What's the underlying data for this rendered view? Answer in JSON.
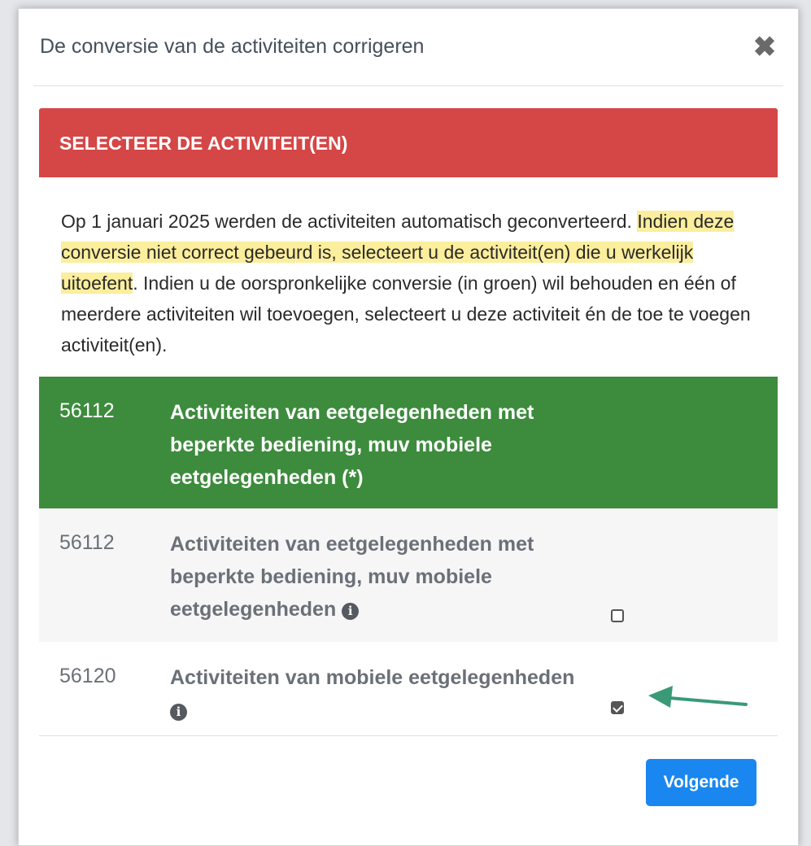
{
  "dialog": {
    "title": "De conversie van de activiteiten corrigeren",
    "close_icon": "close-icon",
    "close_glyph": "✖"
  },
  "banner": {
    "text": "SELECTEER DE ACTIVITEIT(EN)",
    "color": "#d54646"
  },
  "intro": {
    "part1": "Op 1 januari 2025 werden de activiteiten automatisch geconverteerd. ",
    "highlighted": "Indien deze conversie niet correct gebeurd is, selecteert u de activiteit(en) die u werkelijk uitoefent",
    "part2": ". Indien u de oorspronkelijke conversie (in groen) wil behouden en één of meerdere activiteiten wil toevoegen, selecteert u deze activiteit én de toe te voegen activiteit(en).",
    "highlight_color": "#fbee9c"
  },
  "activities": [
    {
      "code": "56112",
      "description": "Activiteiten van eetgelegenheden met beperkte bediening, muv mobiele eetgelegenheden (*)",
      "style": "original-conversion",
      "color": "#3d8b3d"
    },
    {
      "code": "56112",
      "description": "Activiteiten van eetgelegenheden met beperkte bediening, muv mobiele eetgelegenheden",
      "info_icon": "info-icon",
      "checked": false
    },
    {
      "code": "56120",
      "description": "Activiteiten van mobiele eetgelegenheden",
      "info_icon": "info-icon",
      "checked": true
    }
  ],
  "annotation": {
    "icon": "arrow-left-icon",
    "color": "#3a9a78"
  },
  "footer": {
    "next_label": "Volgende",
    "button_color": "#1a87f0"
  }
}
